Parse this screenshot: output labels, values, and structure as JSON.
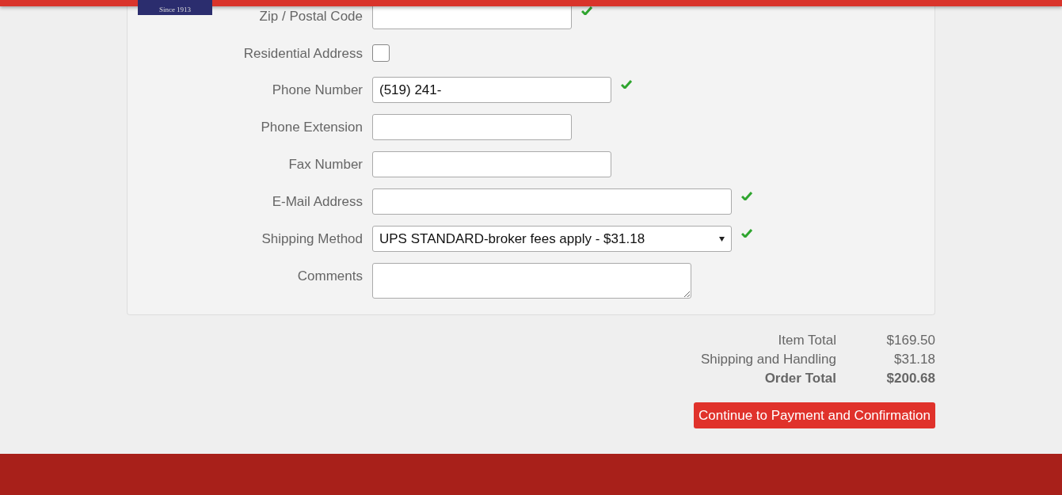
{
  "logo": {
    "tagline": "Since 1913"
  },
  "fields": [
    {
      "label": "Zip / Postal Code",
      "kind": "short",
      "valid": true
    },
    {
      "label": "Residential Address",
      "kind": "checkbox",
      "checked": false,
      "valid": false
    },
    {
      "label": "Phone Number",
      "kind": "long",
      "value": "(519) 241-",
      "valid": true
    },
    {
      "label": "Phone Extension",
      "kind": "short",
      "valid": false
    },
    {
      "label": "Fax Number",
      "kind": "long",
      "valid": false
    },
    {
      "label": "E-Mail Address",
      "kind": "wide",
      "valid": true
    },
    {
      "label": "Shipping Method",
      "kind": "select",
      "value": "UPS STANDARD-broker fees apply - $31.18",
      "valid": true
    },
    {
      "label": "Comments",
      "kind": "textarea",
      "valid": false
    }
  ],
  "totals": [
    {
      "label": "Item Total",
      "value": "$169.50",
      "emphasis": false
    },
    {
      "label": "Shipping and Handling",
      "value": "$31.18",
      "emphasis": false
    },
    {
      "label": "Order Total",
      "value": "$200.68",
      "emphasis": true
    }
  ],
  "continue_button": "Continue to Payment and Confirmation"
}
